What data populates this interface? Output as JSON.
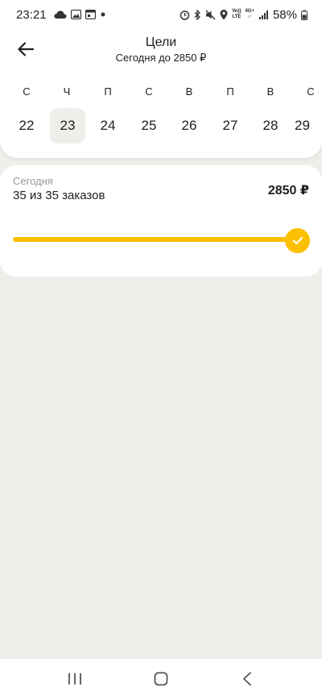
{
  "status_bar": {
    "time": "23:21",
    "lte_top": "Vo))",
    "lte_bottom": "LTE",
    "net_top": "4G+",
    "net_bottom": "↓↑",
    "battery": "58%",
    "icons": [
      "cloud-icon",
      "gallery-icon",
      "calendar-icon",
      "dot-icon",
      "alarm-icon",
      "bluetooth-icon",
      "mute-icon",
      "location-icon",
      "signal-icon",
      "battery-icon"
    ]
  },
  "header": {
    "title": "Цели",
    "subtitle": "Сегодня до 2850 ₽"
  },
  "calendar": {
    "days": [
      {
        "weekday": "С",
        "day": "22",
        "selected": false
      },
      {
        "weekday": "Ч",
        "day": "23",
        "selected": true
      },
      {
        "weekday": "П",
        "day": "24",
        "selected": false
      },
      {
        "weekday": "С",
        "day": "25",
        "selected": false
      },
      {
        "weekday": "В",
        "day": "26",
        "selected": false
      },
      {
        "weekday": "П",
        "day": "27",
        "selected": false
      },
      {
        "weekday": "В",
        "day": "28",
        "selected": false
      },
      {
        "weekday": "С",
        "day": "29",
        "selected": false
      }
    ]
  },
  "progress": {
    "label": "Сегодня",
    "orders": "35 из 35 заказов",
    "amount": "2850 ₽",
    "fraction": 1.0,
    "accent": "#fcc000"
  },
  "nav": {
    "icons": [
      "recent-apps-icon",
      "home-icon",
      "back-nav-icon"
    ]
  }
}
